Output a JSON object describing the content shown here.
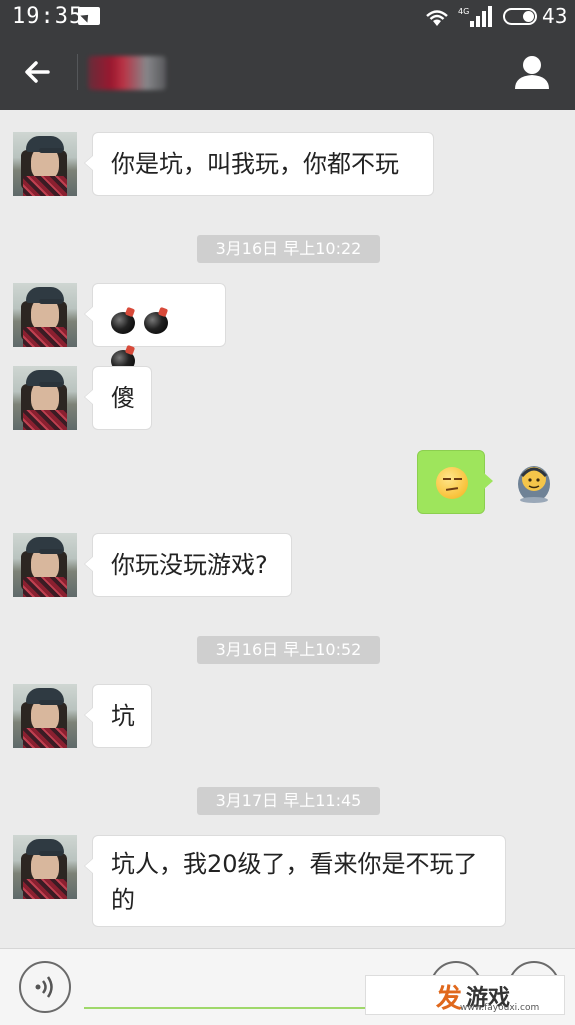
{
  "status_bar": {
    "time": "19:35",
    "network": "4G",
    "battery": "43"
  },
  "header": {
    "contact_name": "",
    "back_icon": "arrow-left-icon",
    "profile_icon": "person-icon"
  },
  "messages": [
    {
      "side": "left",
      "text": "你是坑，叫我玩，你都不玩"
    },
    {
      "type": "timestamp",
      "text": "3月16日 早上10:22"
    },
    {
      "side": "left",
      "emoji": [
        "bomb",
        "bomb",
        "bomb"
      ]
    },
    {
      "side": "left",
      "text": "傻"
    },
    {
      "side": "right",
      "emoji": [
        "smirk"
      ]
    },
    {
      "side": "left",
      "text": "你玩没玩游戏?"
    },
    {
      "type": "timestamp",
      "text": "3月16日 早上10:52"
    },
    {
      "side": "left",
      "text": "坑"
    },
    {
      "type": "timestamp",
      "text": "3月17日 早上11:45"
    },
    {
      "side": "left",
      "text": "坑人，我20级了，看来你是不玩了的"
    }
  ],
  "input_bar": {
    "voice_icon": "voice-icon",
    "emoji_icon": "emoji-icon",
    "plus_icon": "plus-icon"
  },
  "watermark": {
    "brand_char": "发",
    "brand_rest": "游戏",
    "url": "www.fayouxi.com"
  },
  "colors": {
    "header_bg": "#3b3c3e",
    "chat_bg": "#ebebeb",
    "sent_bubble": "#9ee55c",
    "received_bubble": "#ffffff",
    "timestamp_bg": "#cfcfcf"
  }
}
